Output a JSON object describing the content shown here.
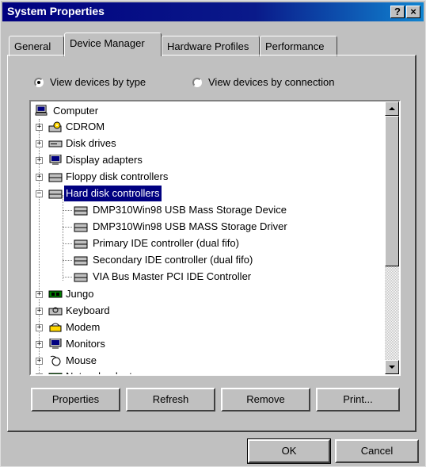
{
  "window": {
    "title": "System Properties",
    "help_label": "?",
    "close_label": "×"
  },
  "tabs": [
    {
      "label": "General"
    },
    {
      "label": "Device Manager"
    },
    {
      "label": "Hardware Profiles"
    },
    {
      "label": "Performance"
    }
  ],
  "view_options": {
    "by_type": "View devices by type",
    "by_connection": "View devices by connection",
    "selected": "by_type"
  },
  "tree": {
    "root": "Computer",
    "items": [
      {
        "label": "CDROM",
        "icon": "cdrom-icon"
      },
      {
        "label": "Disk drives",
        "icon": "disk-drive-icon"
      },
      {
        "label": "Display adapters",
        "icon": "monitor-icon"
      },
      {
        "label": "Floppy disk controllers",
        "icon": "controller-icon"
      },
      {
        "label": "Hard disk controllers",
        "icon": "controller-icon",
        "expanded": true,
        "selected": true,
        "children": [
          "DMP310Win98 USB Mass Storage Device",
          "DMP310Win98 USB MASS Storage Driver",
          "Primary IDE controller (dual fifo)",
          "Secondary IDE controller (dual fifo)",
          "VIA Bus Master PCI IDE Controller"
        ]
      },
      {
        "label": "Jungo",
        "icon": "board-icon"
      },
      {
        "label": "Keyboard",
        "icon": "keyboard-icon"
      },
      {
        "label": "Modem",
        "icon": "modem-icon"
      },
      {
        "label": "Monitors",
        "icon": "monitor-icon"
      },
      {
        "label": "Mouse",
        "icon": "mouse-icon"
      },
      {
        "label": "Network adapters",
        "icon": "network-icon"
      }
    ]
  },
  "buttons": {
    "properties": "Properties",
    "refresh": "Refresh",
    "remove": "Remove",
    "print": "Print...",
    "ok": "OK",
    "cancel": "Cancel"
  },
  "colors": {
    "title_bar": "#000080",
    "selection": "#000080",
    "face": "#c0c0c0"
  }
}
